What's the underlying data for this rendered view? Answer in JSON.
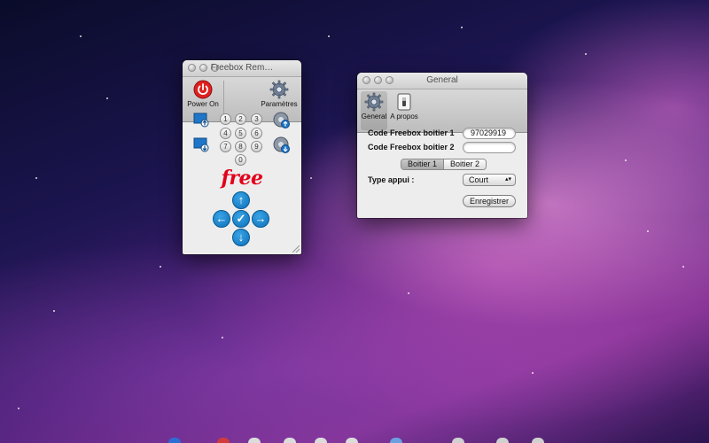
{
  "remote_window": {
    "title": "Freebox Rem…",
    "toolbar": {
      "power_label": "Power On",
      "params_label": "Paramètres"
    },
    "numpad": [
      "1",
      "2",
      "3",
      "4",
      "5",
      "6",
      "7",
      "8",
      "9",
      "0"
    ],
    "logo_text": "free",
    "colors": {
      "logo": "#e2001a",
      "arrows": "#1b84cf",
      "power": "#e02020"
    }
  },
  "general_window": {
    "title": "General",
    "toolbar": {
      "general_label": "General",
      "about_label": "A propos"
    },
    "form": {
      "code1_label": "Code Freebox boitier 1",
      "code1_value": "97029919",
      "code2_label": "Code Freebox boitier 2",
      "code2_value": "",
      "segments": [
        "Boitier 1",
        "Boitier 2"
      ],
      "selected_segment": "Boitier 1",
      "type_label": "Type appui :",
      "type_value": "Court",
      "save_label": "Enregistrer"
    }
  }
}
